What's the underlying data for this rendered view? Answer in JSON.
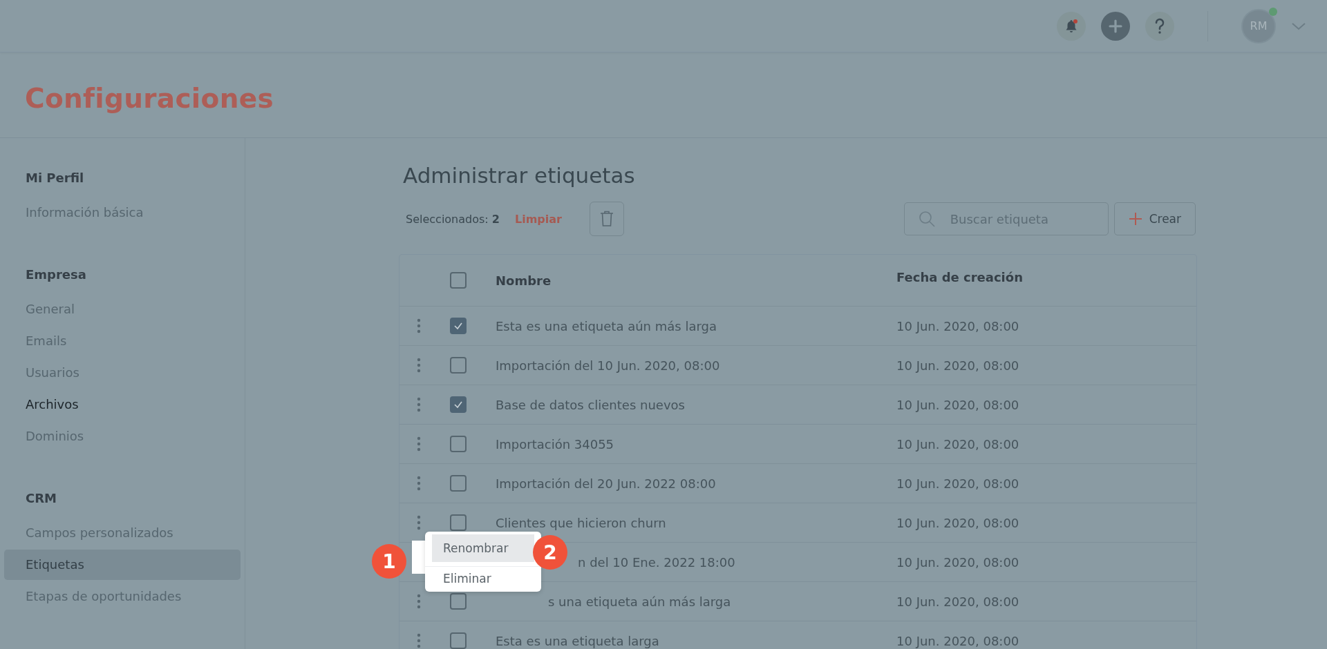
{
  "topbar": {
    "notification_dot": true,
    "avatar": {
      "initials": "RM",
      "online": true
    }
  },
  "page_title": "Configuraciones",
  "sidebar": {
    "sections": [
      {
        "title": "Mi Perfil",
        "items": [
          {
            "label": "Información básica",
            "selected": false,
            "emphasis": false
          }
        ]
      },
      {
        "title": "Empresa",
        "items": [
          {
            "label": "General",
            "selected": false,
            "emphasis": false
          },
          {
            "label": "Emails",
            "selected": false,
            "emphasis": false
          },
          {
            "label": "Usuarios",
            "selected": false,
            "emphasis": false
          },
          {
            "label": "Archivos",
            "selected": false,
            "emphasis": true
          },
          {
            "label": "Dominios",
            "selected": false,
            "emphasis": false
          }
        ]
      },
      {
        "title": "CRM",
        "items": [
          {
            "label": "Campos personalizados",
            "selected": false,
            "emphasis": false
          },
          {
            "label": "Etiquetas",
            "selected": true,
            "emphasis": false
          },
          {
            "label": "Etapas de oportunidades",
            "selected": false,
            "emphasis": false
          }
        ]
      }
    ]
  },
  "content": {
    "heading": "Administrar etiquetas",
    "selection": "Seleccionados: **2**",
    "clear_link": "Limpiar",
    "search": {
      "placeholder": "Buscar etiqueta"
    },
    "create_button": "Crear",
    "table": {
      "header_checked": false,
      "columns": [
        "Nombre",
        "Fecha de creación"
      ],
      "rows": [
        {
          "name": "Esta es una etiqueta aún más larga",
          "date": "10 Jun. 2020, 08:00",
          "checked": true,
          "partly_hidden": false,
          "menu_open": false
        },
        {
          "name": "Importación del 10 Jun. 2020, 08:00",
          "date": "10 Jun. 2020, 08:00",
          "checked": false,
          "partly_hidden": false,
          "menu_open": false
        },
        {
          "name": "Base de datos clientes nuevos",
          "date": "10 Jun. 2020, 08:00",
          "checked": true,
          "partly_hidden": false,
          "menu_open": false
        },
        {
          "name": "Importación 34055",
          "date": "10 Jun. 2020, 08:00",
          "checked": false,
          "partly_hidden": false,
          "menu_open": false
        },
        {
          "name": "Importación del 20 Jun. 2022 08:00",
          "date": "10 Jun. 2020, 08:00",
          "checked": false,
          "partly_hidden": false,
          "menu_open": false
        },
        {
          "name": "Clientes que hicieron churn",
          "date": "10 Jun. 2020, 08:00",
          "checked": false,
          "partly_hidden": false,
          "menu_open": false
        },
        {
          "name": "n del 10 Ene. 2022 18:00",
          "date": "10 Jun. 2020, 08:00",
          "checked": false,
          "partly_hidden": true,
          "menu_open": true
        },
        {
          "name": "s una etiqueta aún más larga",
          "date": "10 Jun. 2020, 08:00",
          "checked": false,
          "partly_hidden": true,
          "menu_open": false
        },
        {
          "name": "Esta es una etiqueta larga",
          "date": "10 Jun. 2020, 08:00",
          "checked": false,
          "partly_hidden": false,
          "menu_open": false
        }
      ]
    },
    "row_menu": [
      {
        "label": "Renombrar",
        "selected": true
      },
      {
        "label": "Eliminar",
        "selected": false
      }
    ],
    "tutorial_steps": [
      "1",
      "2"
    ]
  }
}
